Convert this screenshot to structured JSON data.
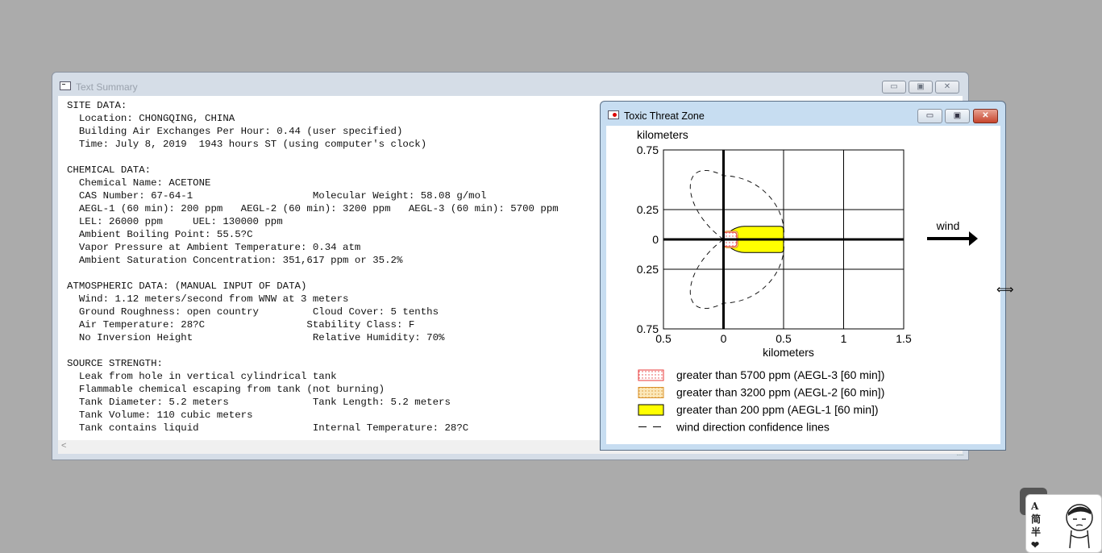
{
  "text_summary_window": {
    "title": "Text Summary",
    "lines": [
      "SITE DATA:",
      "  Location: CHONGQING, CHINA",
      "  Building Air Exchanges Per Hour: 0.44 (user specified)",
      "  Time: July 8, 2019  1943 hours ST (using computer's clock)",
      "",
      "CHEMICAL DATA:",
      "  Chemical Name: ACETONE",
      "  CAS Number: 67-64-1                    Molecular Weight: 58.08 g/mol",
      "  AEGL-1 (60 min): 200 ppm   AEGL-2 (60 min): 3200 ppm   AEGL-3 (60 min): 5700 ppm",
      "  LEL: 26000 ppm     UEL: 130000 ppm",
      "  Ambient Boiling Point: 55.5?C",
      "  Vapor Pressure at Ambient Temperature: 0.34 atm",
      "  Ambient Saturation Concentration: 351,617 ppm or 35.2%",
      "",
      "ATMOSPHERIC DATA: (MANUAL INPUT OF DATA)",
      "  Wind: 1.12 meters/second from WNW at 3 meters",
      "  Ground Roughness: open country         Cloud Cover: 5 tenths",
      "  Air Temperature: 28?C                 Stability Class: F",
      "  No Inversion Height                    Relative Humidity: 70%",
      "",
      "SOURCE STRENGTH:",
      "  Leak from hole in vertical cylindrical tank",
      "  Flammable chemical escaping from tank (not burning)",
      "  Tank Diameter: 5.2 meters              Tank Length: 5.2 meters",
      "  Tank Volume: 110 cubic meters",
      "  Tank contains liquid                   Internal Temperature: 28?C"
    ],
    "scroll_left_arrow": "<",
    "size_grip": "....."
  },
  "threat_zone_window": {
    "title": "Toxic Threat Zone",
    "y_unit_label": "kilometers",
    "x_unit_label": "kilometers",
    "wind_label": "wind",
    "legend": [
      {
        "text": "greater than 5700 ppm (AEGL-3 [60 min])",
        "color": "#e83a3a",
        "style": "red-dotted"
      },
      {
        "text": "greater than 3200 ppm (AEGL-2 [60 min])",
        "color": "#f2b24a",
        "style": "orange-dotted"
      },
      {
        "text": "greater than 200 ppm (AEGL-1 [60 min])",
        "color": "#ffff00",
        "style": "yellow-fill"
      },
      {
        "text": "wind direction confidence lines",
        "color": "#000000",
        "style": "dashed"
      }
    ]
  },
  "chart_data": {
    "type": "area",
    "xlabel": "kilometers",
    "ylabel": "kilometers",
    "x_ticks": [
      "0.5",
      "0",
      "0.5",
      "1",
      "1.5"
    ],
    "y_ticks": [
      "0.75",
      "0.25",
      "0",
      "0.25",
      "0.75"
    ],
    "xlim": [
      -0.5,
      1.5
    ],
    "ylim": [
      -0.75,
      0.75
    ],
    "grid": true,
    "zones": [
      {
        "name": "AEGL-3 (>5700 ppm)",
        "max_downwind_km": 0.11,
        "max_half_width_km": 0.06
      },
      {
        "name": "AEGL-2 (>3200 ppm)",
        "max_downwind_km": 0.12,
        "max_half_width_km": 0.07
      },
      {
        "name": "AEGL-1 (>200 ppm)",
        "max_downwind_km": 0.5,
        "max_half_width_km": 0.11
      }
    ],
    "confidence_line_max_half_width_km": 0.52,
    "wind_direction": "east"
  },
  "helper_widget": {
    "chars": [
      "A",
      "简",
      "半",
      "❤"
    ]
  }
}
